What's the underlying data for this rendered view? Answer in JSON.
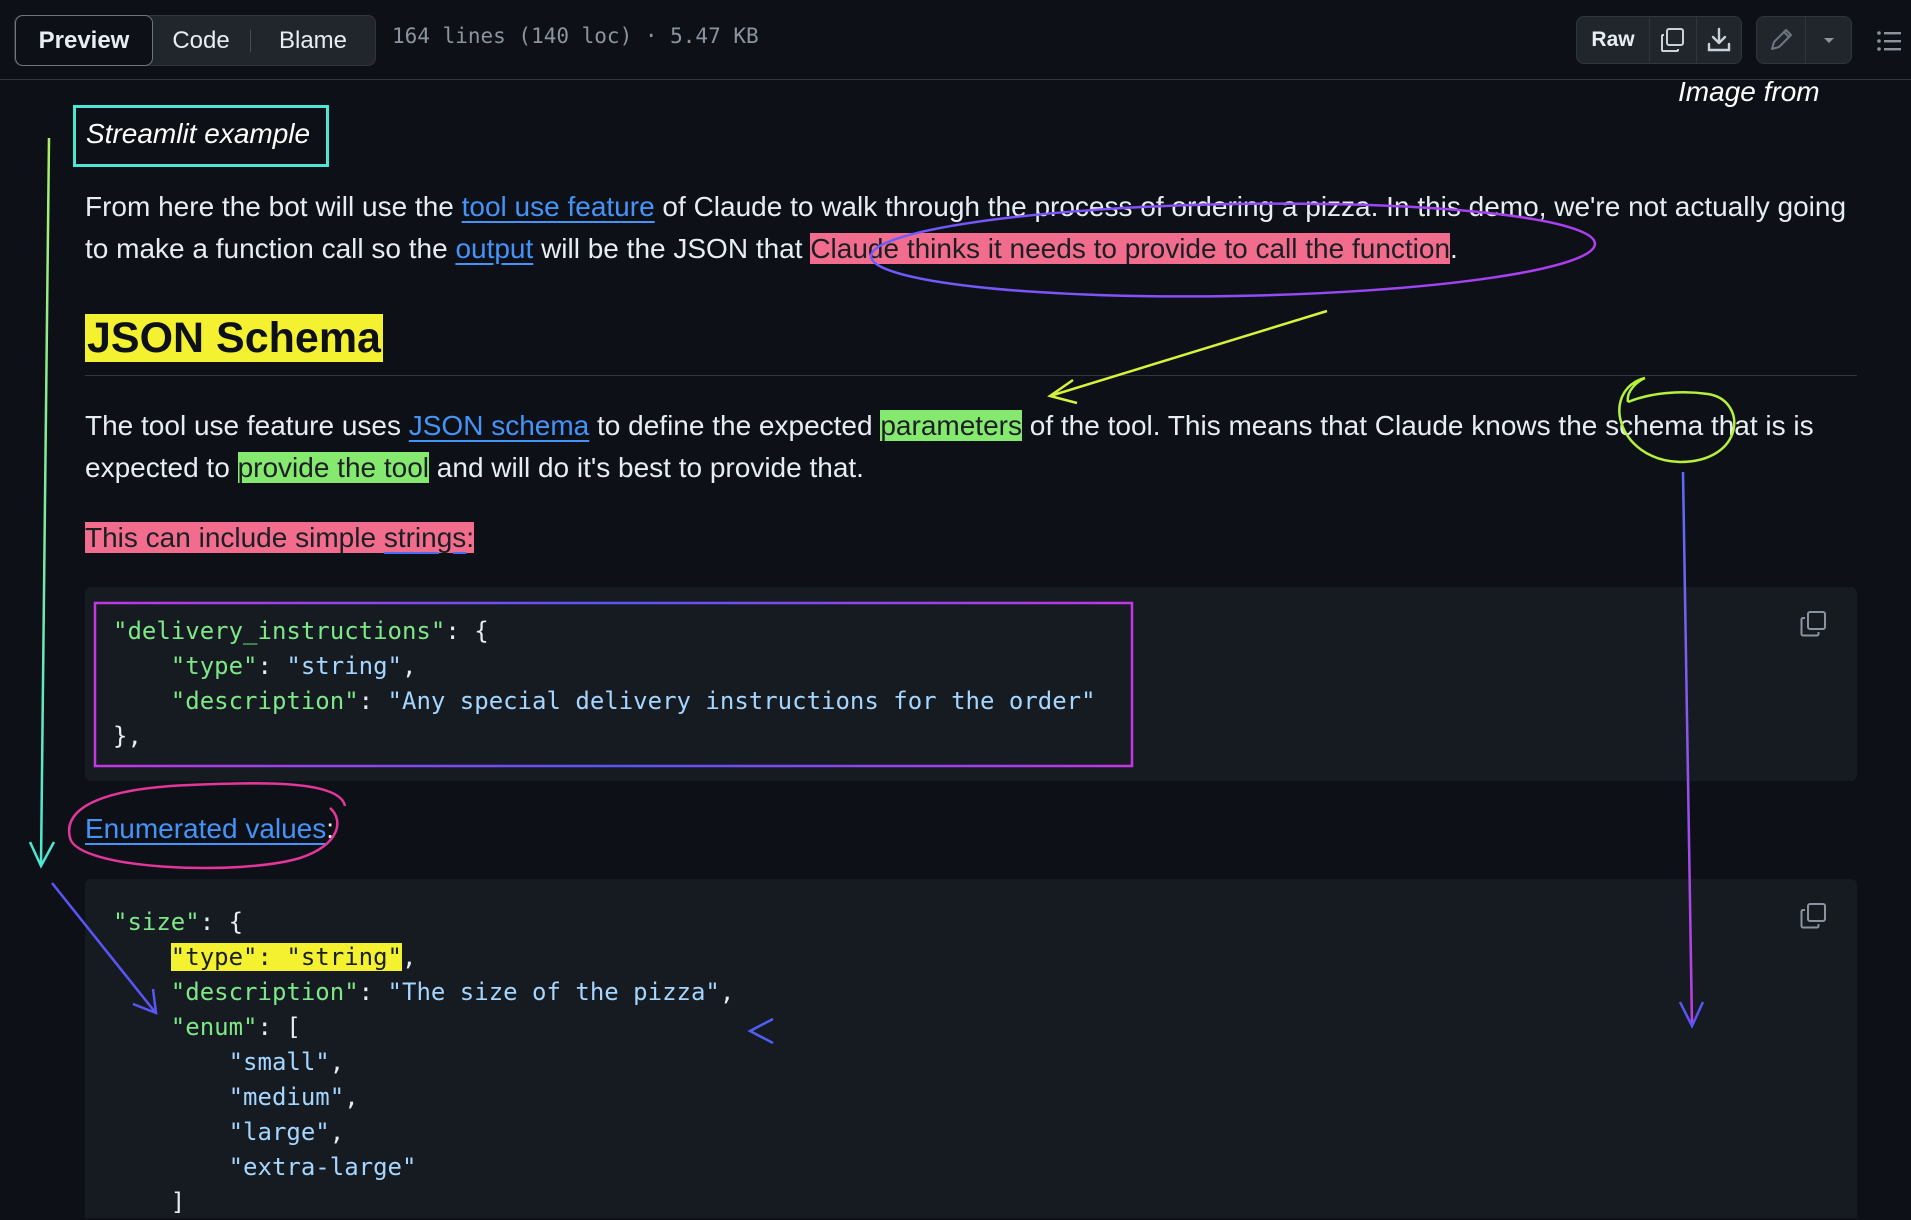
{
  "toolbar": {
    "tabs": [
      {
        "label": "Preview",
        "active": true
      },
      {
        "label": "Code",
        "active": false
      },
      {
        "label": "Blame",
        "active": false
      }
    ],
    "file_info": "164 lines (140 loc) · 5.47 KB",
    "raw_label": "Raw",
    "icons": [
      "copy-icon",
      "download-icon",
      "pencil-icon",
      "chevron-down-icon",
      "list-icon"
    ]
  },
  "annotations": {
    "image_from": "Image from",
    "streamlit_example": "Streamlit example"
  },
  "content": {
    "para1": {
      "t1": "From here the bot will use the ",
      "link1": "tool use feature",
      "t2": " of Claude to walk through the process of ordering a pizza. In this demo, we're not actually going to make a function call so the ",
      "link2": "output",
      "t3": " will be the JSON that ",
      "hl": "Claude thinks it needs to provide to call the function",
      "t4": "."
    },
    "heading": "JSON Schema",
    "para2": {
      "t1": "The tool use feature uses ",
      "link1": "JSON schema",
      "t2": " to define the expected ",
      "hl1": "parameters",
      "t3": " of the tool. This means that Claude knows the schema that is is expected to ",
      "hl2": "provide the tool",
      "t4": " and will do it's best to provide that."
    },
    "para3": {
      "t1": "This can include simple ",
      "t2": "strings",
      "t3": ":"
    },
    "code1": {
      "l1k": "\"delivery_instructions\"",
      "l1p": ": {",
      "l2k": "\"type\"",
      "l2p": ": ",
      "l2s": "\"string\"",
      "l2e": ",",
      "l3k": "\"description\"",
      "l3p": ": ",
      "l3s": "\"Any special delivery instructions for the order\"",
      "l4": "},"
    },
    "enum_link": "Enumerated values",
    "enum_colon": ":",
    "code2": {
      "l1k": "\"size\"",
      "l1p": ": {",
      "l2k": "\"type\"",
      "l2p": ": ",
      "l2s": "\"string\"",
      "l2e": ",",
      "l3k": "\"description\"",
      "l3p": ": ",
      "l3s": "\"The size of the pizza\"",
      "l3e": ",",
      "l4k": "\"enum\"",
      "l4p": ": [",
      "v1": "\"small\"",
      "v2": "\"medium\"",
      "v3": "\"large\"",
      "v4": "\"extra-large\"",
      "comma": ",",
      "close": "]"
    }
  },
  "colors": {
    "background": "#0d1117",
    "link": "#4493f8",
    "highlight_pink": "#f26d8d",
    "highlight_green": "#86e96f",
    "highlight_yellow": "#f4f230"
  }
}
